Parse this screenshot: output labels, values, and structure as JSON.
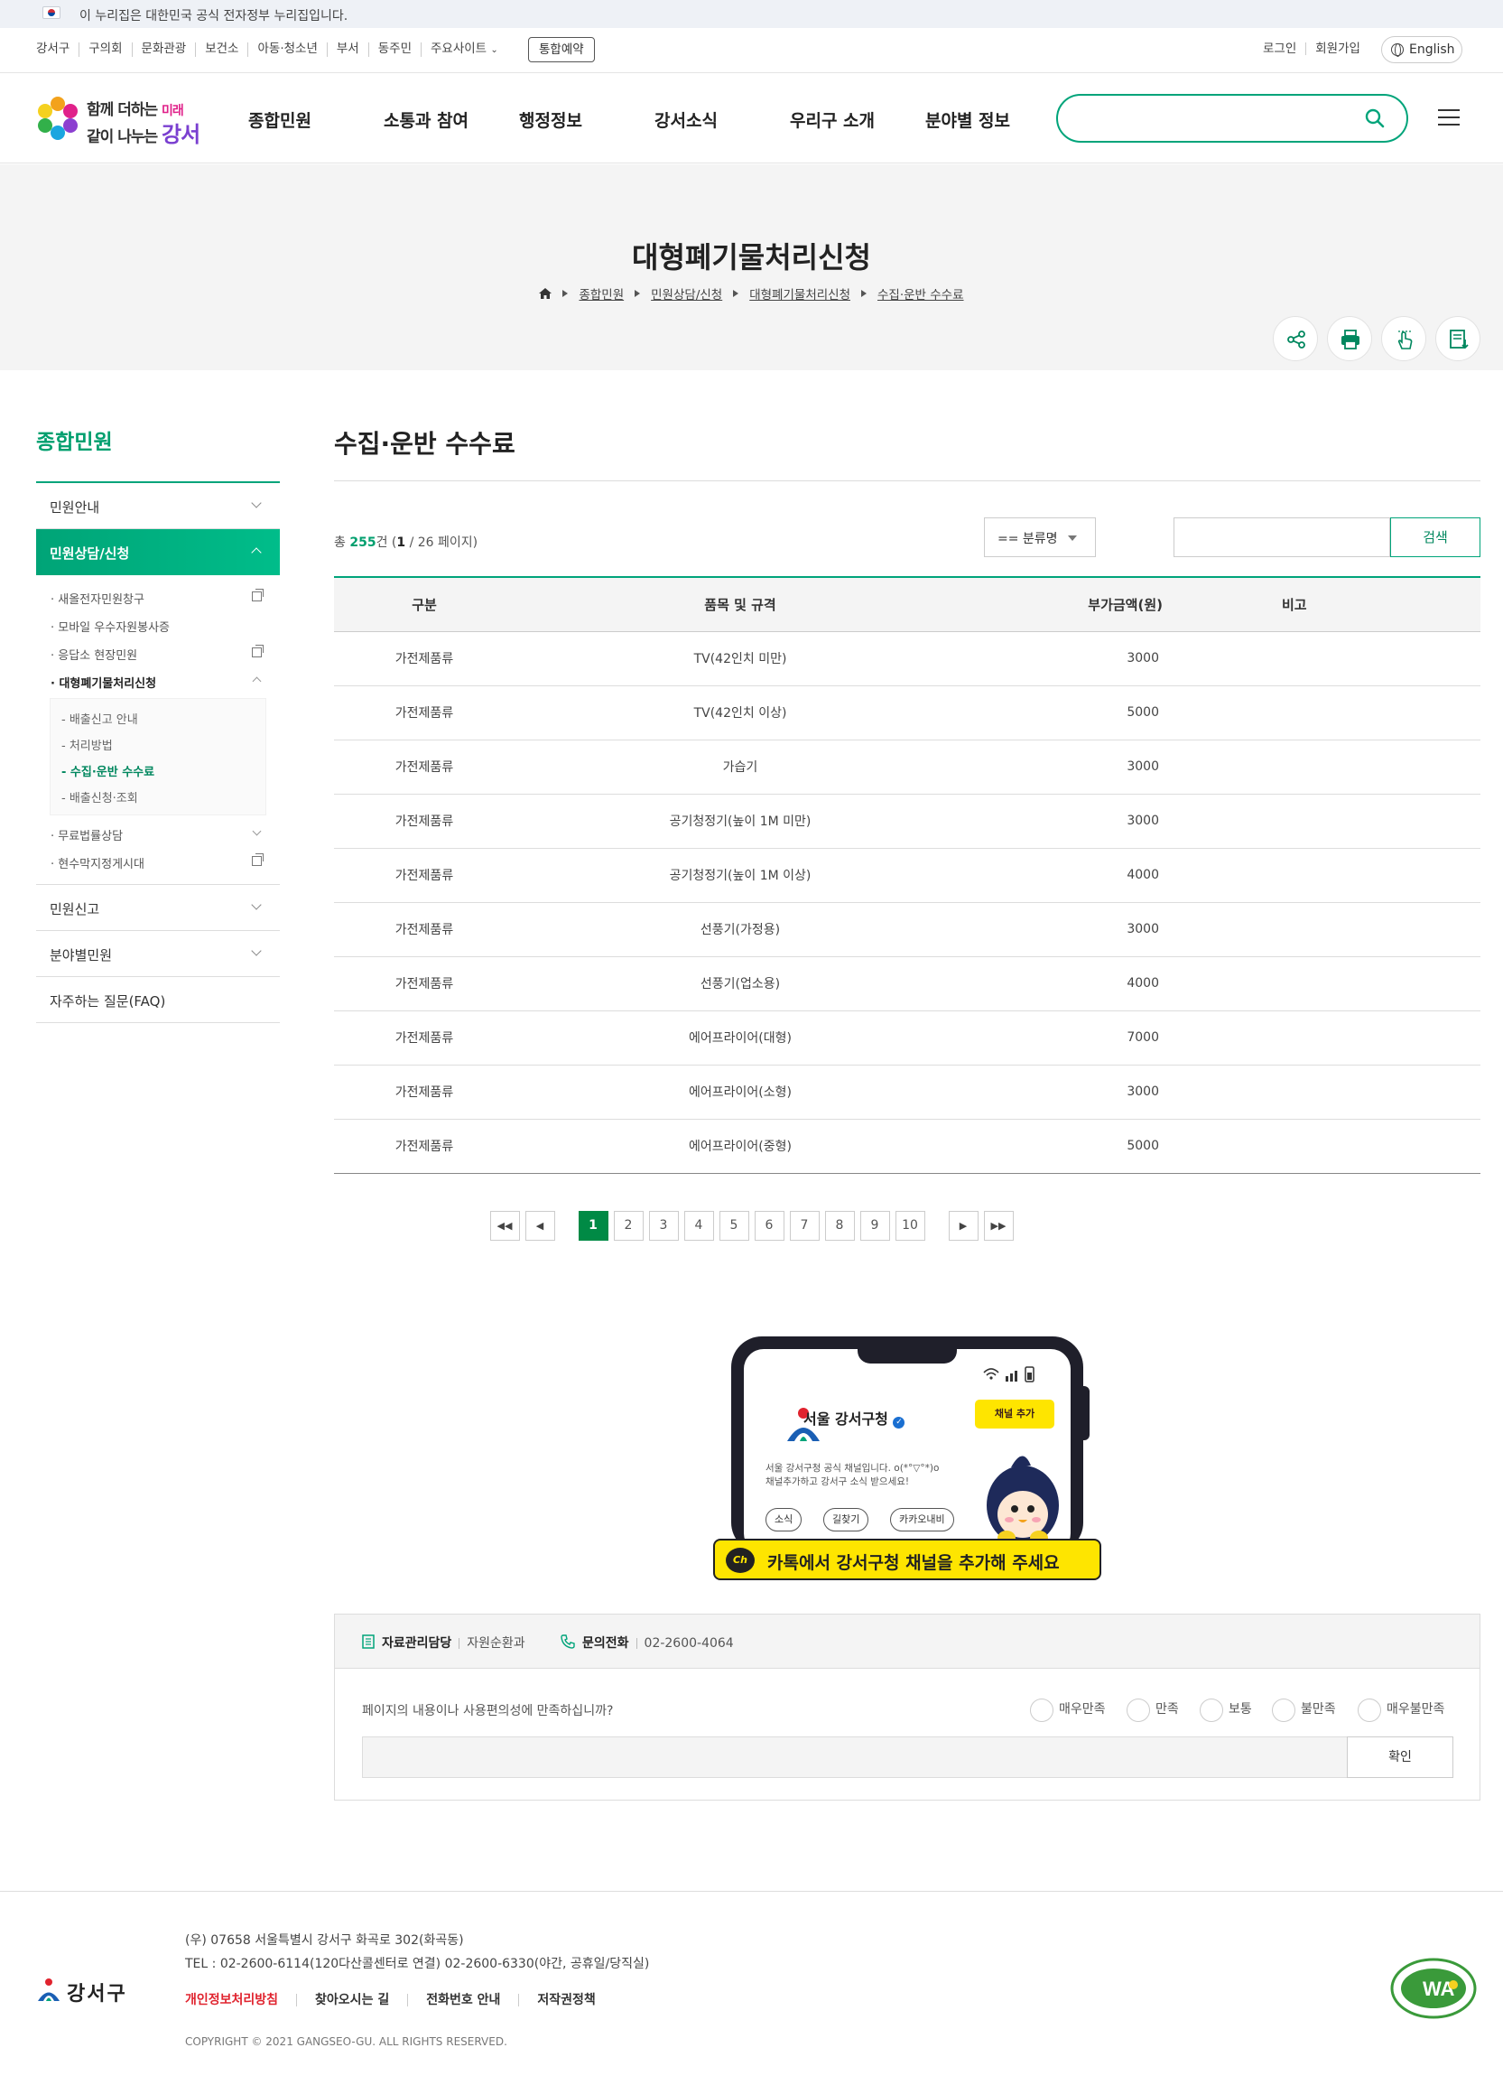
{
  "gov_banner": {
    "text": "이 누리집은 대한민국 공식 전자정부 누리집입니다."
  },
  "util": {
    "links": [
      "강서구",
      "구의회",
      "문화관광",
      "보건소",
      "아동·청소년",
      "부서",
      "동주민",
      "주요사이트"
    ],
    "reserve": "통합예약",
    "login": "로그인",
    "join": "회원가입",
    "lang": "English"
  },
  "logo": {
    "line1_a": "함께 더하는 ",
    "line1_b": "미래",
    "line2_a": "같이 나누는 ",
    "line2_b": "강서"
  },
  "gnb": [
    "종합민원",
    "소통과 참여",
    "행정정보",
    "강서소식",
    "우리구 소개",
    "분야별 정보"
  ],
  "search": {
    "placeholder": ""
  },
  "page": {
    "title": "대형폐기물처리신청",
    "breadcrumb": [
      "종합민원",
      "민원상담/신청",
      "대형폐기물처리신청",
      "수집·운반 수수료"
    ]
  },
  "lnb": {
    "title": "종합민원",
    "items": [
      {
        "label": "민원안내"
      },
      {
        "label": "민원상담/신청"
      },
      {
        "label": "민원신고"
      },
      {
        "label": "분야별민원"
      },
      {
        "label": "자주하는 질문(FAQ)"
      }
    ],
    "sub": [
      "· 새올전자민원창구",
      "· 모바일 우수자원봉사증",
      "· 응답소 현장민원",
      "· 대형폐기물처리신청",
      "· 무료법률상담",
      "· 현수막지정게시대"
    ],
    "sub3": [
      "- 배출신고 안내",
      "- 처리방법",
      "- 수집·운반 수수료",
      "- 배출신청·조회"
    ]
  },
  "content": {
    "title": "수집·운반 수수료",
    "count_prefix": "총 ",
    "count_total": "255",
    "count_mid": "건 (",
    "count_page": "1",
    "count_suffix": " / 26 페이지)",
    "category": "== 분류명",
    "search_btn": "검색"
  },
  "table": {
    "headers": [
      "구분",
      "품목 및 규격",
      "부가금액(원)",
      "비고"
    ],
    "rows": [
      [
        "가전제품류",
        "TV(42인치 미만)",
        "3000",
        ""
      ],
      [
        "가전제품류",
        "TV(42인치 이상)",
        "5000",
        ""
      ],
      [
        "가전제품류",
        "가습기",
        "3000",
        ""
      ],
      [
        "가전제품류",
        "공기청정기(높이 1M 미만)",
        "3000",
        ""
      ],
      [
        "가전제품류",
        "공기청정기(높이 1M 이상)",
        "4000",
        ""
      ],
      [
        "가전제품류",
        "선풍기(가정용)",
        "3000",
        ""
      ],
      [
        "가전제품류",
        "선풍기(업소용)",
        "4000",
        ""
      ],
      [
        "가전제품류",
        "에어프라이어(대형)",
        "7000",
        ""
      ],
      [
        "가전제품류",
        "에어프라이어(소형)",
        "3000",
        ""
      ],
      [
        "가전제품류",
        "에어프라이어(중형)",
        "5000",
        ""
      ]
    ]
  },
  "pager": {
    "pages": [
      "1",
      "2",
      "3",
      "4",
      "5",
      "6",
      "7",
      "8",
      "9",
      "10"
    ],
    "first": "◀◀",
    "prev": "◀",
    "next": "▶",
    "last": "▶▶"
  },
  "kakao": {
    "channel_name": "서울 강서구청",
    "add_btn": "채널 추가",
    "desc1": "서울 강서구청 공식 채널입니다. o(*°▽°*)o",
    "desc2": "채널추가하고 강서구 소식 받으세요!",
    "chips": [
      "소식",
      "길찾기",
      "카카오내비"
    ],
    "ch_icon": "Ch",
    "banner_a": "카톡에서 ",
    "banner_b": "강서구청 채널을 추가해 주세요"
  },
  "survey": {
    "manager_label": "자료관리담당",
    "manager_value": "자원순환과",
    "phone_label": "문의전화",
    "phone_value": "02-2600-4064",
    "question": "페이지의 내용이나 사용편의성에 만족하십니까?",
    "options": [
      "매우만족",
      "만족",
      "보통",
      "불만족",
      "매우불만족"
    ],
    "confirm": "확인"
  },
  "footer": {
    "logo_text": "강서구",
    "address": "(우) 07658 서울특별시 강서구 화곡로 302(화곡동)",
    "tel": "TEL : 02-2600-6114(120다산콜센터로 연결) 02-2600-6330(야간, 공휴일/당직실)",
    "links": [
      "개인정보처리방침",
      "찾아오시는 길",
      "전화번호 안내",
      "저작권정책"
    ],
    "copyright": "COPYRIGHT © 2021 GANGSEO-GU. ALL RIGHTS RESERVED.",
    "wa_text": "WA"
  },
  "colors": {
    "accent": "#00a47a",
    "pager_active": "#008a45",
    "kakao_yellow": "#fee500"
  }
}
